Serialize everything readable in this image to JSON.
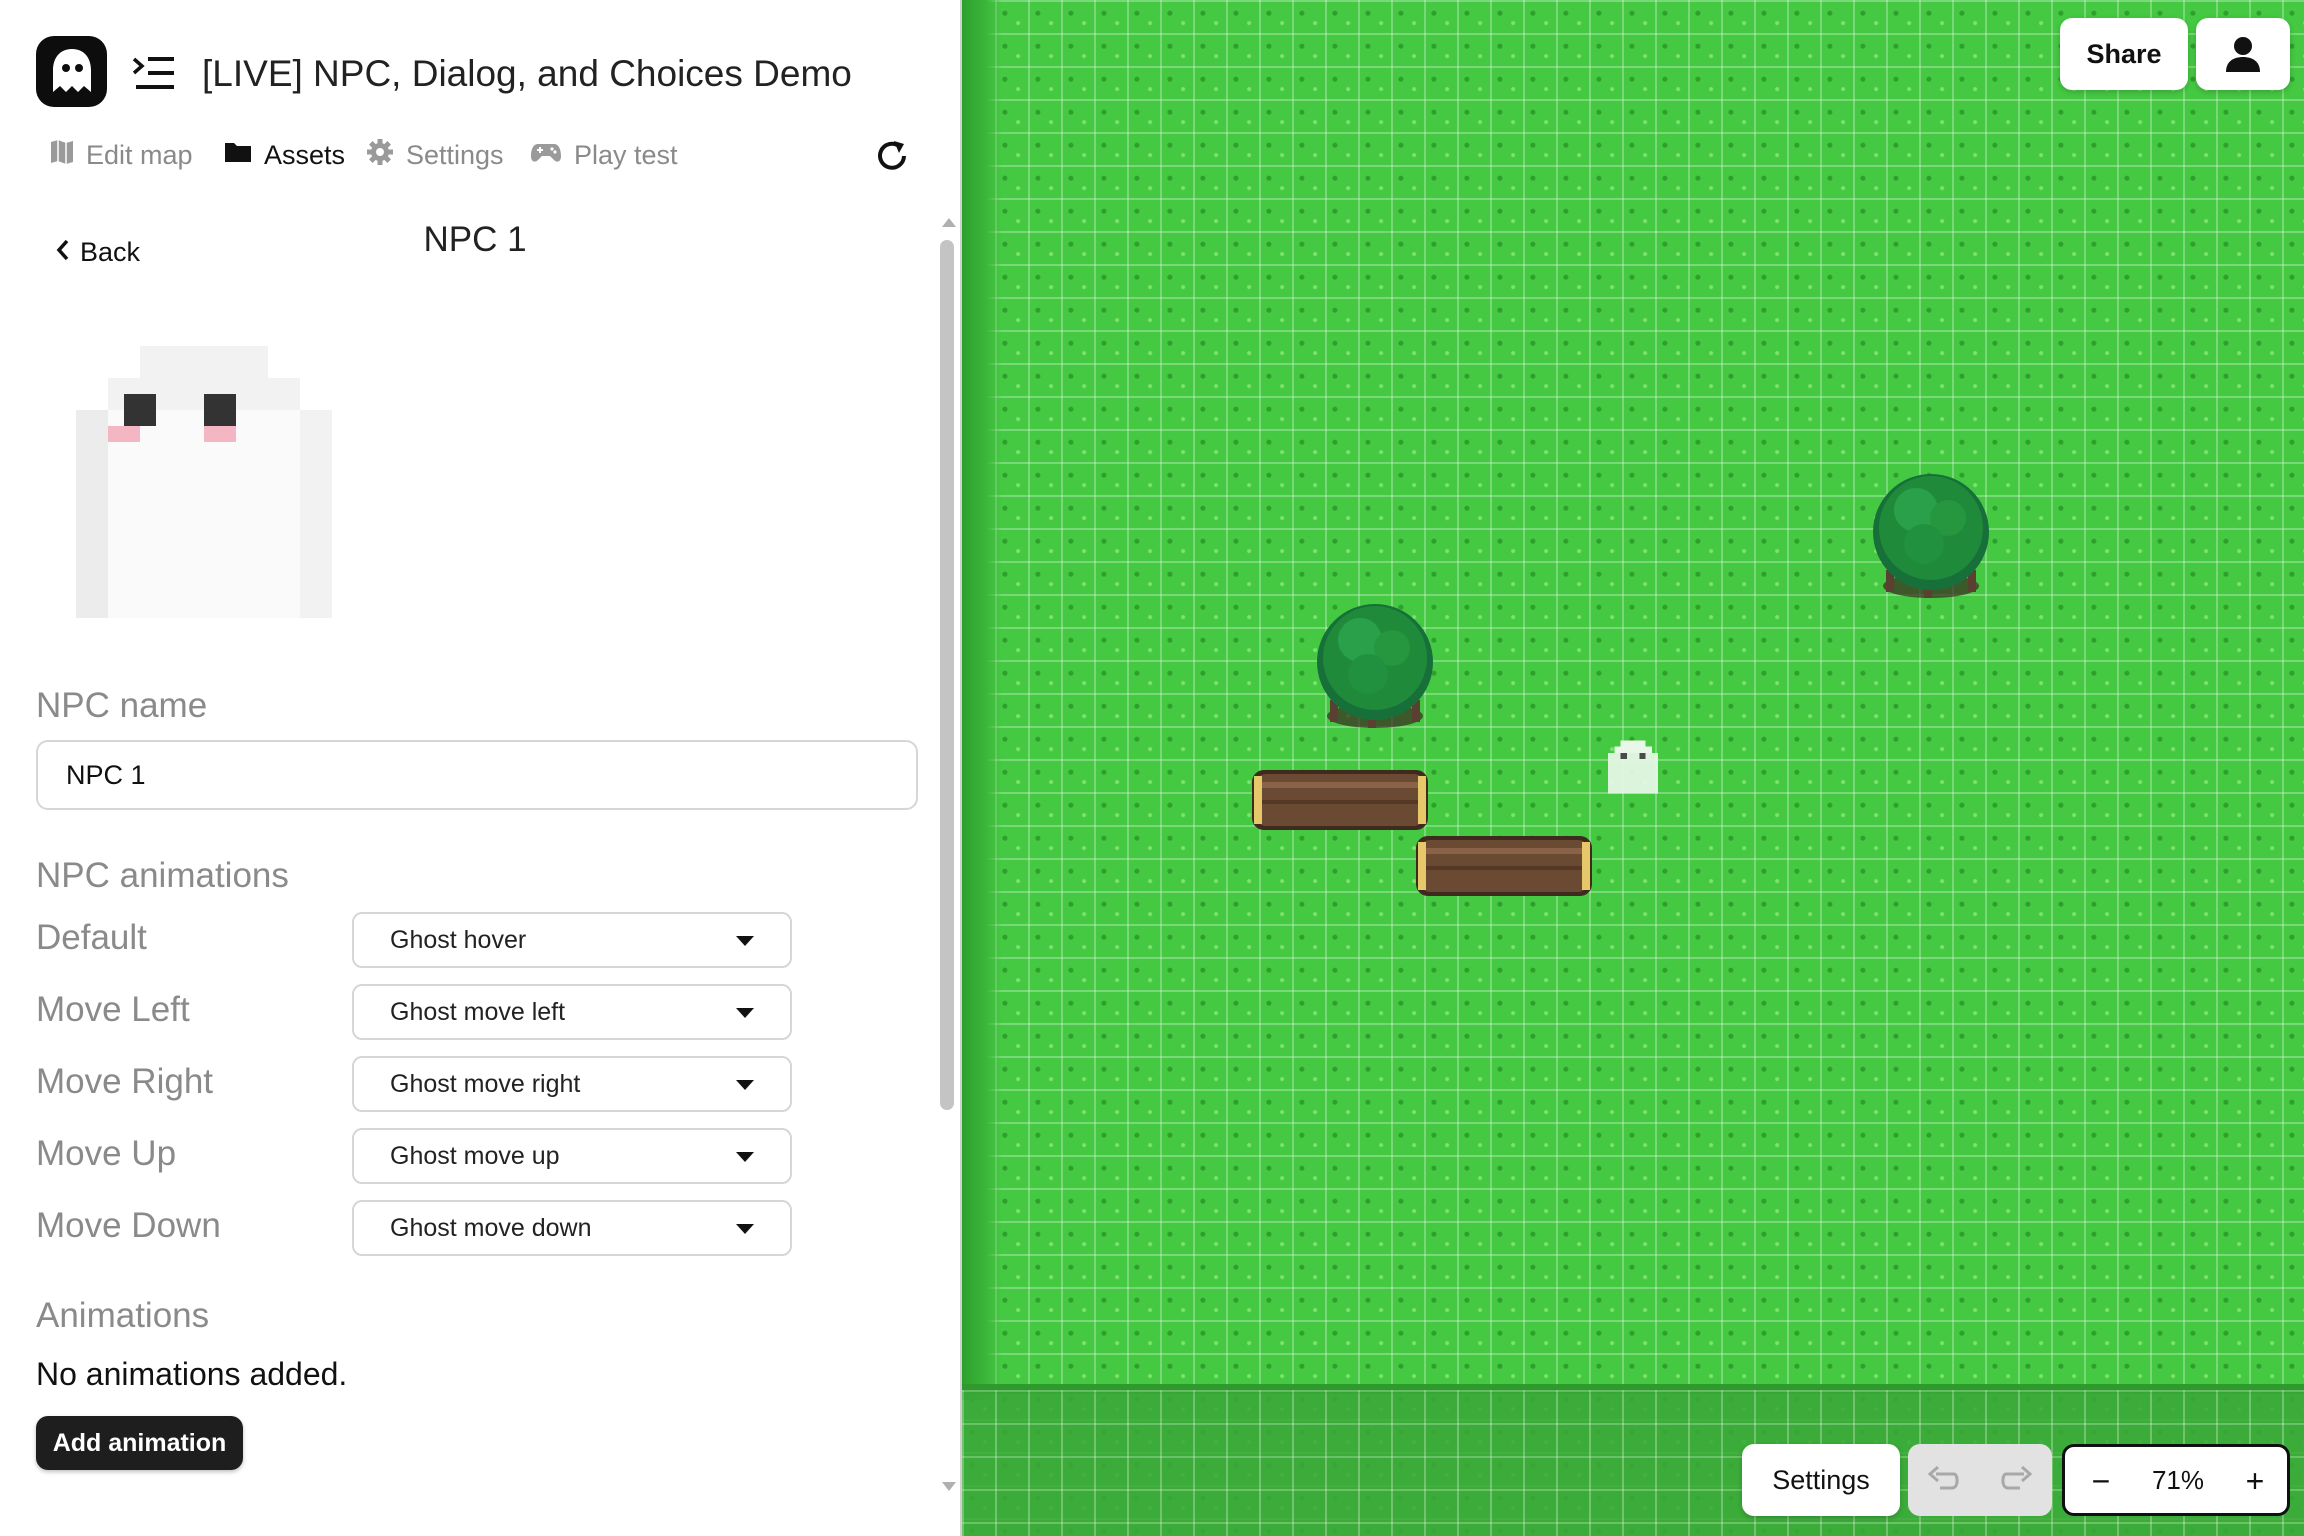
{
  "header": {
    "project_title": "[LIVE] NPC, Dialog, and Choices Demo"
  },
  "tabs": [
    {
      "label": "Edit map",
      "icon": "map-icon",
      "active": false
    },
    {
      "label": "Assets",
      "icon": "folder-icon",
      "active": true
    },
    {
      "label": "Settings",
      "icon": "gear-icon",
      "active": false
    },
    {
      "label": "Play test",
      "icon": "gamepad-icon",
      "active": false
    }
  ],
  "asset_editor": {
    "back_label": "Back",
    "title": "NPC 1",
    "name_label": "NPC name",
    "name_value": "NPC 1",
    "npc_animations_label": "NPC animations",
    "animation_slots": [
      {
        "label": "Default",
        "value": "Ghost hover"
      },
      {
        "label": "Move Left",
        "value": "Ghost move left"
      },
      {
        "label": "Move Right",
        "value": "Ghost move right"
      },
      {
        "label": "Move Up",
        "value": "Ghost move up"
      },
      {
        "label": "Move Down",
        "value": "Ghost move down"
      }
    ],
    "animations_label": "Animations",
    "no_animations_text": "No animations added.",
    "add_animation_label": "Add animation"
  },
  "map_toolbar": {
    "share_label": "Share",
    "settings_label": "Settings",
    "zoom_out_label": "−",
    "zoom_level": "71%",
    "zoom_in_label": "+"
  },
  "colors": {
    "grass": "#45c943",
    "tree_foliage": "#1f8a3a",
    "log_brown": "#6b4a34",
    "ghost": "#f2f2f2",
    "dark_button": "#1e1e1e"
  }
}
